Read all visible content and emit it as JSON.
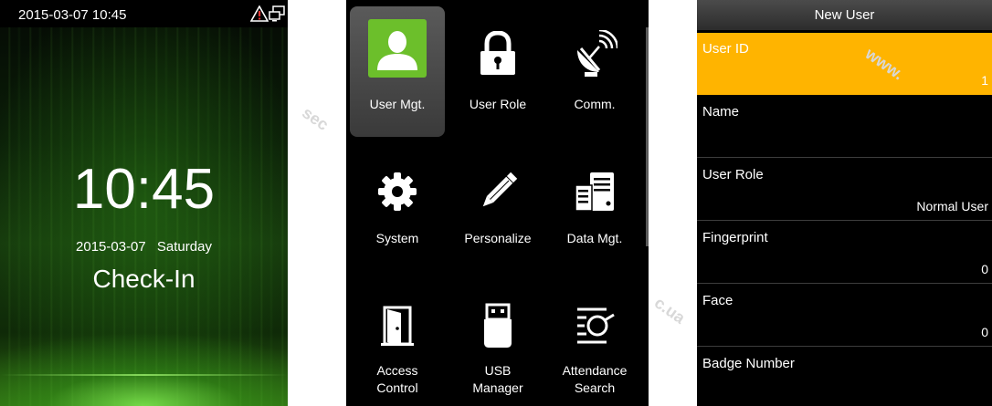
{
  "standby": {
    "status_time": "2015-03-07 10:45",
    "clock": "10:45",
    "date": "2015-03-07",
    "weekday": "Saturday",
    "punch_state": "Check-In"
  },
  "menu": {
    "items": [
      {
        "label": "User Mgt.",
        "icon": "user-icon",
        "selected": true
      },
      {
        "label": "User Role",
        "icon": "lock-icon"
      },
      {
        "label": "Comm.",
        "icon": "satellite-dish-icon"
      },
      {
        "label": "System",
        "icon": "gear-icon"
      },
      {
        "label": "Personalize",
        "icon": "pencil-icon"
      },
      {
        "label": "Data Mgt.",
        "icon": "server-icon"
      },
      {
        "label": "Access Control",
        "label_lines": [
          "Access",
          "Control"
        ],
        "icon": "door-icon"
      },
      {
        "label": "USB Manager",
        "label_lines": [
          "USB",
          "Manager"
        ],
        "icon": "usb-drive-icon"
      },
      {
        "label": "Attendance Search",
        "label_lines": [
          "Attendance",
          "Search"
        ],
        "icon": "search-doc-icon"
      }
    ]
  },
  "new_user": {
    "title": "New User",
    "fields": [
      {
        "label": "User ID",
        "value": "1",
        "selected": true
      },
      {
        "label": "Name",
        "value": ""
      },
      {
        "label": "User Role",
        "value": "Normal User"
      },
      {
        "label": "Fingerprint",
        "value": "0"
      },
      {
        "label": "Face",
        "value": "0"
      },
      {
        "label": "Badge Number",
        "value": ""
      }
    ]
  },
  "colors": {
    "selected_field": "#ffb400",
    "user_icon_green": "#6cbf2b",
    "menu_background": "#000000"
  }
}
